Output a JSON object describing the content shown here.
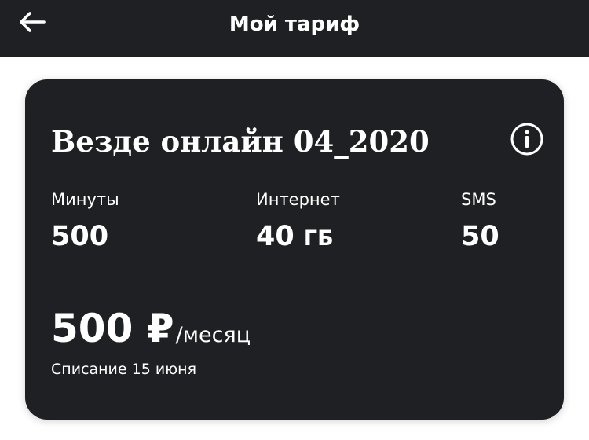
{
  "header": {
    "title": "Мой тариф",
    "back_icon": "arrow-left-icon"
  },
  "tariff": {
    "name": "Везде онлайн 04_2020",
    "info_icon": "info-icon",
    "stats": {
      "minutes": {
        "label": "Минуты",
        "value": "500"
      },
      "internet": {
        "label": "Интернет",
        "value": "40",
        "unit": "ГБ"
      },
      "sms": {
        "label": "SMS",
        "value": "50"
      }
    },
    "price": {
      "amount": "500 ₽",
      "period": "/месяц"
    },
    "charge_date": "Списание 15 июня"
  },
  "colors": {
    "background": "#ffffff",
    "card": "#1f2023",
    "header": "#1f2023",
    "text": "#ffffff"
  }
}
